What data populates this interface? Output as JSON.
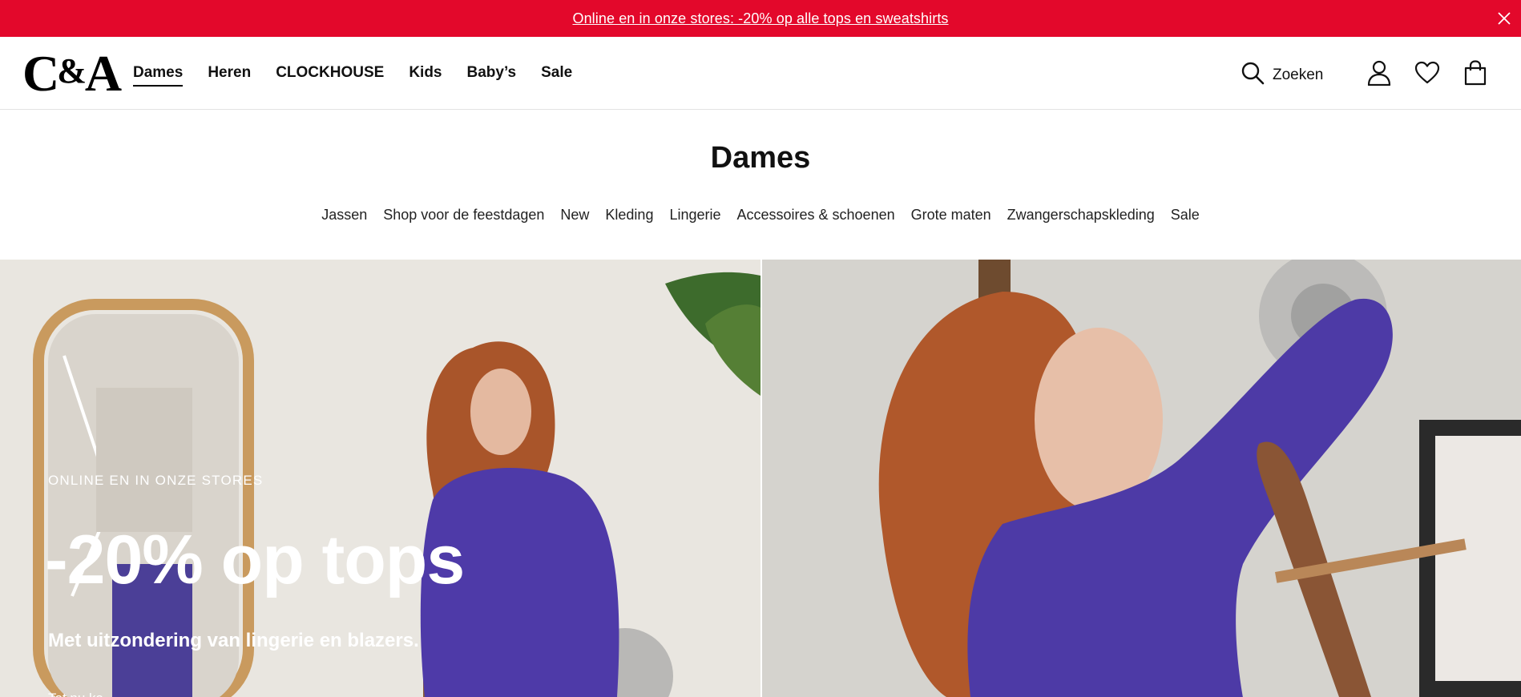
{
  "promo": {
    "text": "Online en in onze stores: -20% op alle tops en sweatshirts",
    "close_icon": "close-icon",
    "background": "#e3082b"
  },
  "header": {
    "logo_left": "C",
    "logo_amp": "&",
    "logo_right": "A",
    "nav": [
      {
        "label": "Dames",
        "active": true
      },
      {
        "label": "Heren",
        "active": false
      },
      {
        "label": "CLOCKHOUSE",
        "active": false
      },
      {
        "label": "Kids",
        "active": false
      },
      {
        "label": "Baby’s",
        "active": false
      },
      {
        "label": "Sale",
        "active": false
      }
    ],
    "search_label": "Zoeken",
    "icons": [
      "search-icon",
      "account-icon",
      "wishlist-heart-icon",
      "shopping-bag-icon"
    ]
  },
  "category": {
    "title": "Dames",
    "subnav": [
      "Jassen",
      "Shop voor de feestdagen",
      "New",
      "Kleding",
      "Lingerie",
      "Accessoires & schoenen",
      "Grote maten",
      "Zwangerschapskleding",
      "Sale"
    ]
  },
  "hero": {
    "eyebrow": "ONLINE EN IN ONZE STORES",
    "headline": "-20% op tops",
    "subline": "Met uitzondering van lingerie en blazers.",
    "cta": "Tot nu ka"
  }
}
